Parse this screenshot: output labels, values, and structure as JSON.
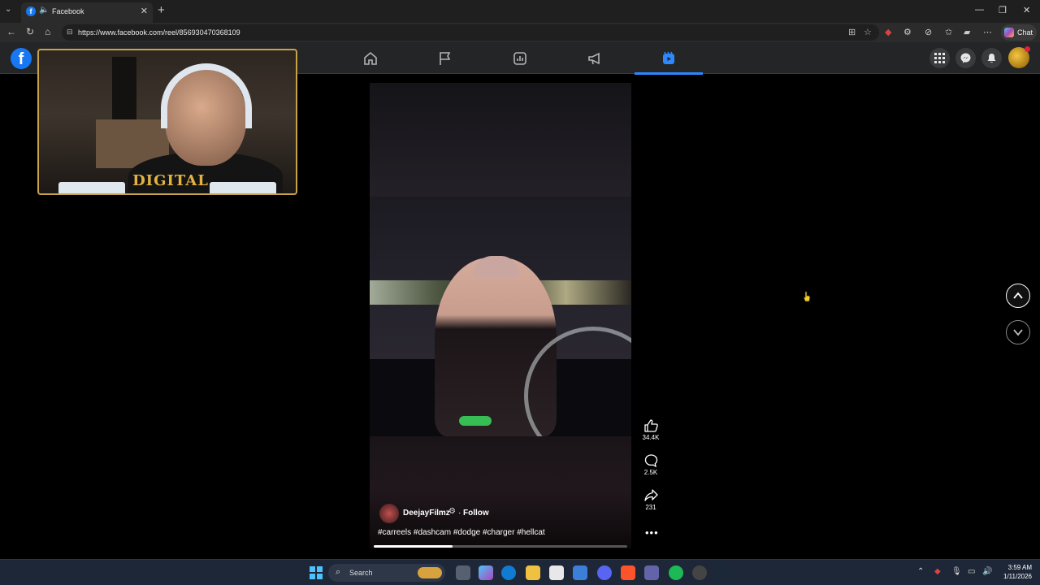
{
  "browser": {
    "tab_title": "Facebook",
    "url": "https://www.facebook.com/reel/856930470368109",
    "chat_label": "Chat"
  },
  "overlay": {
    "brand_text": "DIGITAL"
  },
  "reel": {
    "author": "DeejayFilmz",
    "separator": "·",
    "follow_label": "Follow",
    "caption": "#carreels #dashcam #dodge #charger #hellcat",
    "progress": 0.31,
    "likes": "34.4K",
    "comments": "2.5K",
    "shares": "231"
  },
  "taskbar": {
    "search_label": "Search",
    "time": "3:59 AM",
    "date": "1/11/2026"
  },
  "icons": [
    "home-icon",
    "flag-icon",
    "dashboard-icon",
    "megaphone-icon",
    "reels-icon",
    "apps-grid-icon",
    "messenger-icon",
    "bell-icon",
    "like-icon",
    "comment-icon",
    "share-icon",
    "more-icon",
    "chevron-up-icon",
    "chevron-down-icon"
  ],
  "colors": {
    "fb_blue": "#1877f2",
    "active_tab": "#2d88ff",
    "overlay_gold": "#c9a24a"
  }
}
